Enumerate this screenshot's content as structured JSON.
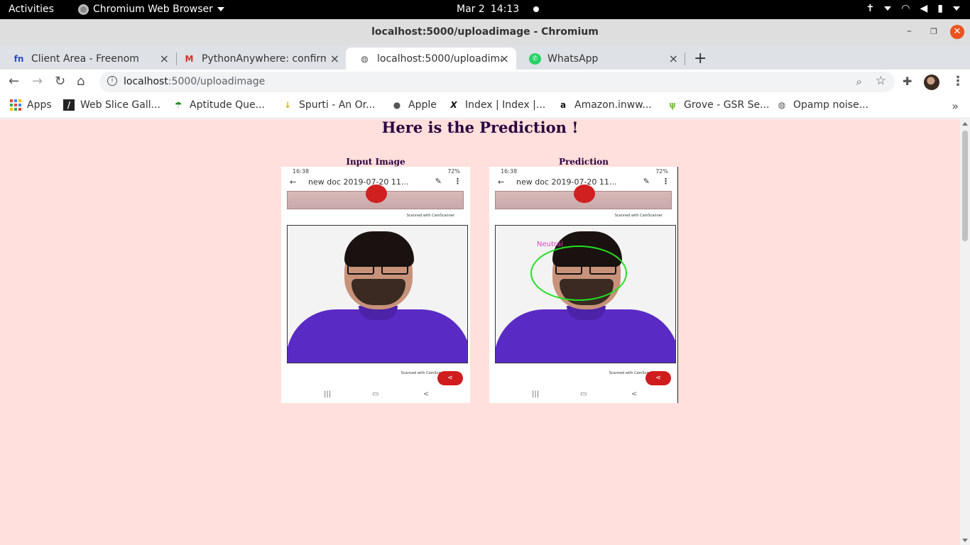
{
  "topbar": {
    "activities": "Activities",
    "app_menu": "Chromium Web Browser",
    "date": "Mar 2",
    "time": "14:13"
  },
  "window": {
    "title": "localhost:5000/uploadimage - Chromium"
  },
  "tabs": [
    {
      "label": "Client Area - Freenom",
      "icon": "freenom-icon",
      "active": false
    },
    {
      "label": "PythonAnywhere: confirm",
      "icon": "gmail-icon",
      "active": false
    },
    {
      "label": "localhost:5000/uploadima",
      "icon": "globe-icon",
      "active": true
    },
    {
      "label": "WhatsApp",
      "icon": "whatsapp-icon",
      "active": false
    }
  ],
  "omnibox": {
    "host": "localhost",
    "path": ":5000/uploadimage"
  },
  "bookmarks": [
    {
      "label": "Apps",
      "icon": "apps-grid-icon"
    },
    {
      "label": "Web Slice Gall...",
      "icon": "web-slice-icon"
    },
    {
      "label": "Aptitude Que...",
      "icon": "aptitude-icon"
    },
    {
      "label": "Spurti - An Or...",
      "icon": "spurti-icon"
    },
    {
      "label": "Apple",
      "icon": "apple-icon"
    },
    {
      "label": "Index | Index |...",
      "icon": "index-icon"
    },
    {
      "label": "Amazon.inww...",
      "icon": "amazon-icon"
    },
    {
      "label": "Grove - GSR Se...",
      "icon": "grove-icon"
    },
    {
      "label": "Opamp noise...",
      "icon": "globe-icon"
    }
  ],
  "page": {
    "title": "Here is the Prediction !",
    "input_caption": "Input Image",
    "prediction_caption": "Prediction",
    "phone": {
      "status_time": "16:38",
      "battery": "72%",
      "doc_name": "new doc 2019-07-20 11...",
      "scanned_text": "Scanned with CamScanner"
    },
    "prediction_label": "Neutral"
  },
  "colors": {
    "page_background": "#ffe0dc",
    "heading": "#2a003f",
    "detection_ellipse": "#22e022",
    "detection_label": "#e040c0"
  }
}
